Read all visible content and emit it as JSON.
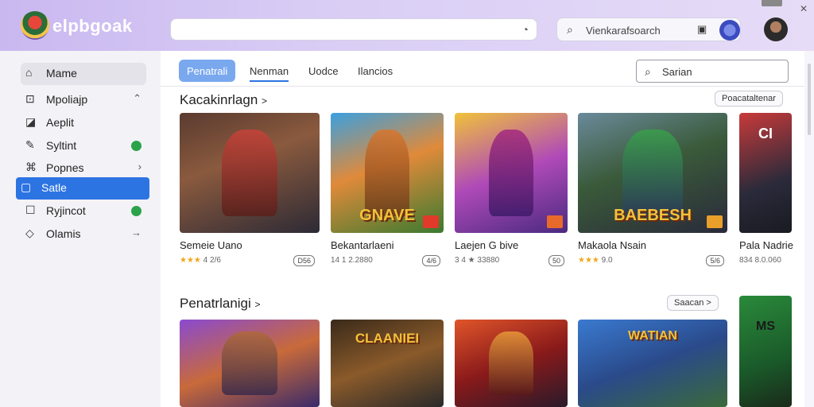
{
  "header": {
    "brand": "elpbgoak",
    "top_search_icon": "chat-search-icon",
    "right_search_text": "Vienkarafsoarch",
    "right_search_icon": "mic-icon"
  },
  "sidebar": {
    "items": [
      {
        "label": "Mame",
        "icon": "home-icon"
      },
      {
        "label": "Mpoliajp",
        "icon": "alert-icon",
        "trail": "^"
      },
      {
        "label": "Aeplit",
        "icon": "chart-icon"
      },
      {
        "label": "Syltint",
        "icon": "pen-icon",
        "trail": "dot"
      },
      {
        "label": "Popnes",
        "icon": "gamepad-icon",
        "trail": ">"
      },
      {
        "label": "Satle",
        "icon": "tag-icon"
      },
      {
        "label": "Ryjincot",
        "icon": "square-icon",
        "trail": "dot"
      },
      {
        "label": "Olamis",
        "icon": "diamond-icon",
        "trail": "→"
      }
    ]
  },
  "tabs": [
    {
      "label": "Penatrali"
    },
    {
      "label": "Nenman"
    },
    {
      "label": "Uodce"
    },
    {
      "label": "Ilancios"
    }
  ],
  "main_search": {
    "text": "Sarian"
  },
  "section1": {
    "title": "Kacakinrlagn",
    "chevron": ">",
    "button": "Poacataltenar"
  },
  "section2": {
    "title": "Penatrlanigi",
    "chevron": ">",
    "button": "Saacan >"
  },
  "row1": [
    {
      "title": "Semeie Uano",
      "stars": "★★★",
      "meta": " 4 2/6",
      "badge": "D56",
      "logo": ""
    },
    {
      "title": "Bekantarlaeni",
      "stars": "",
      "meta": "14 1 2.2880",
      "badge": "4/6",
      "logo": "GNAVE"
    },
    {
      "title": "Laejen G bive",
      "stars": "",
      "meta": "3 4 ★ 33880",
      "badge": "50",
      "logo": ""
    },
    {
      "title": "Makaola Nsain",
      "stars": "★★★",
      "meta": " 9.0",
      "badge": "5/6",
      "logo": "BAEBESH"
    },
    {
      "title": "Pala Nadrie",
      "stars": "",
      "meta": "834 8.0.060",
      "badge": "",
      "logo": "CI"
    }
  ],
  "row2": [
    {
      "logo": ""
    },
    {
      "logo": "CLAANIEI"
    },
    {
      "logo": ""
    },
    {
      "logo": "WATIAN"
    },
    {
      "logo": "MS"
    }
  ]
}
